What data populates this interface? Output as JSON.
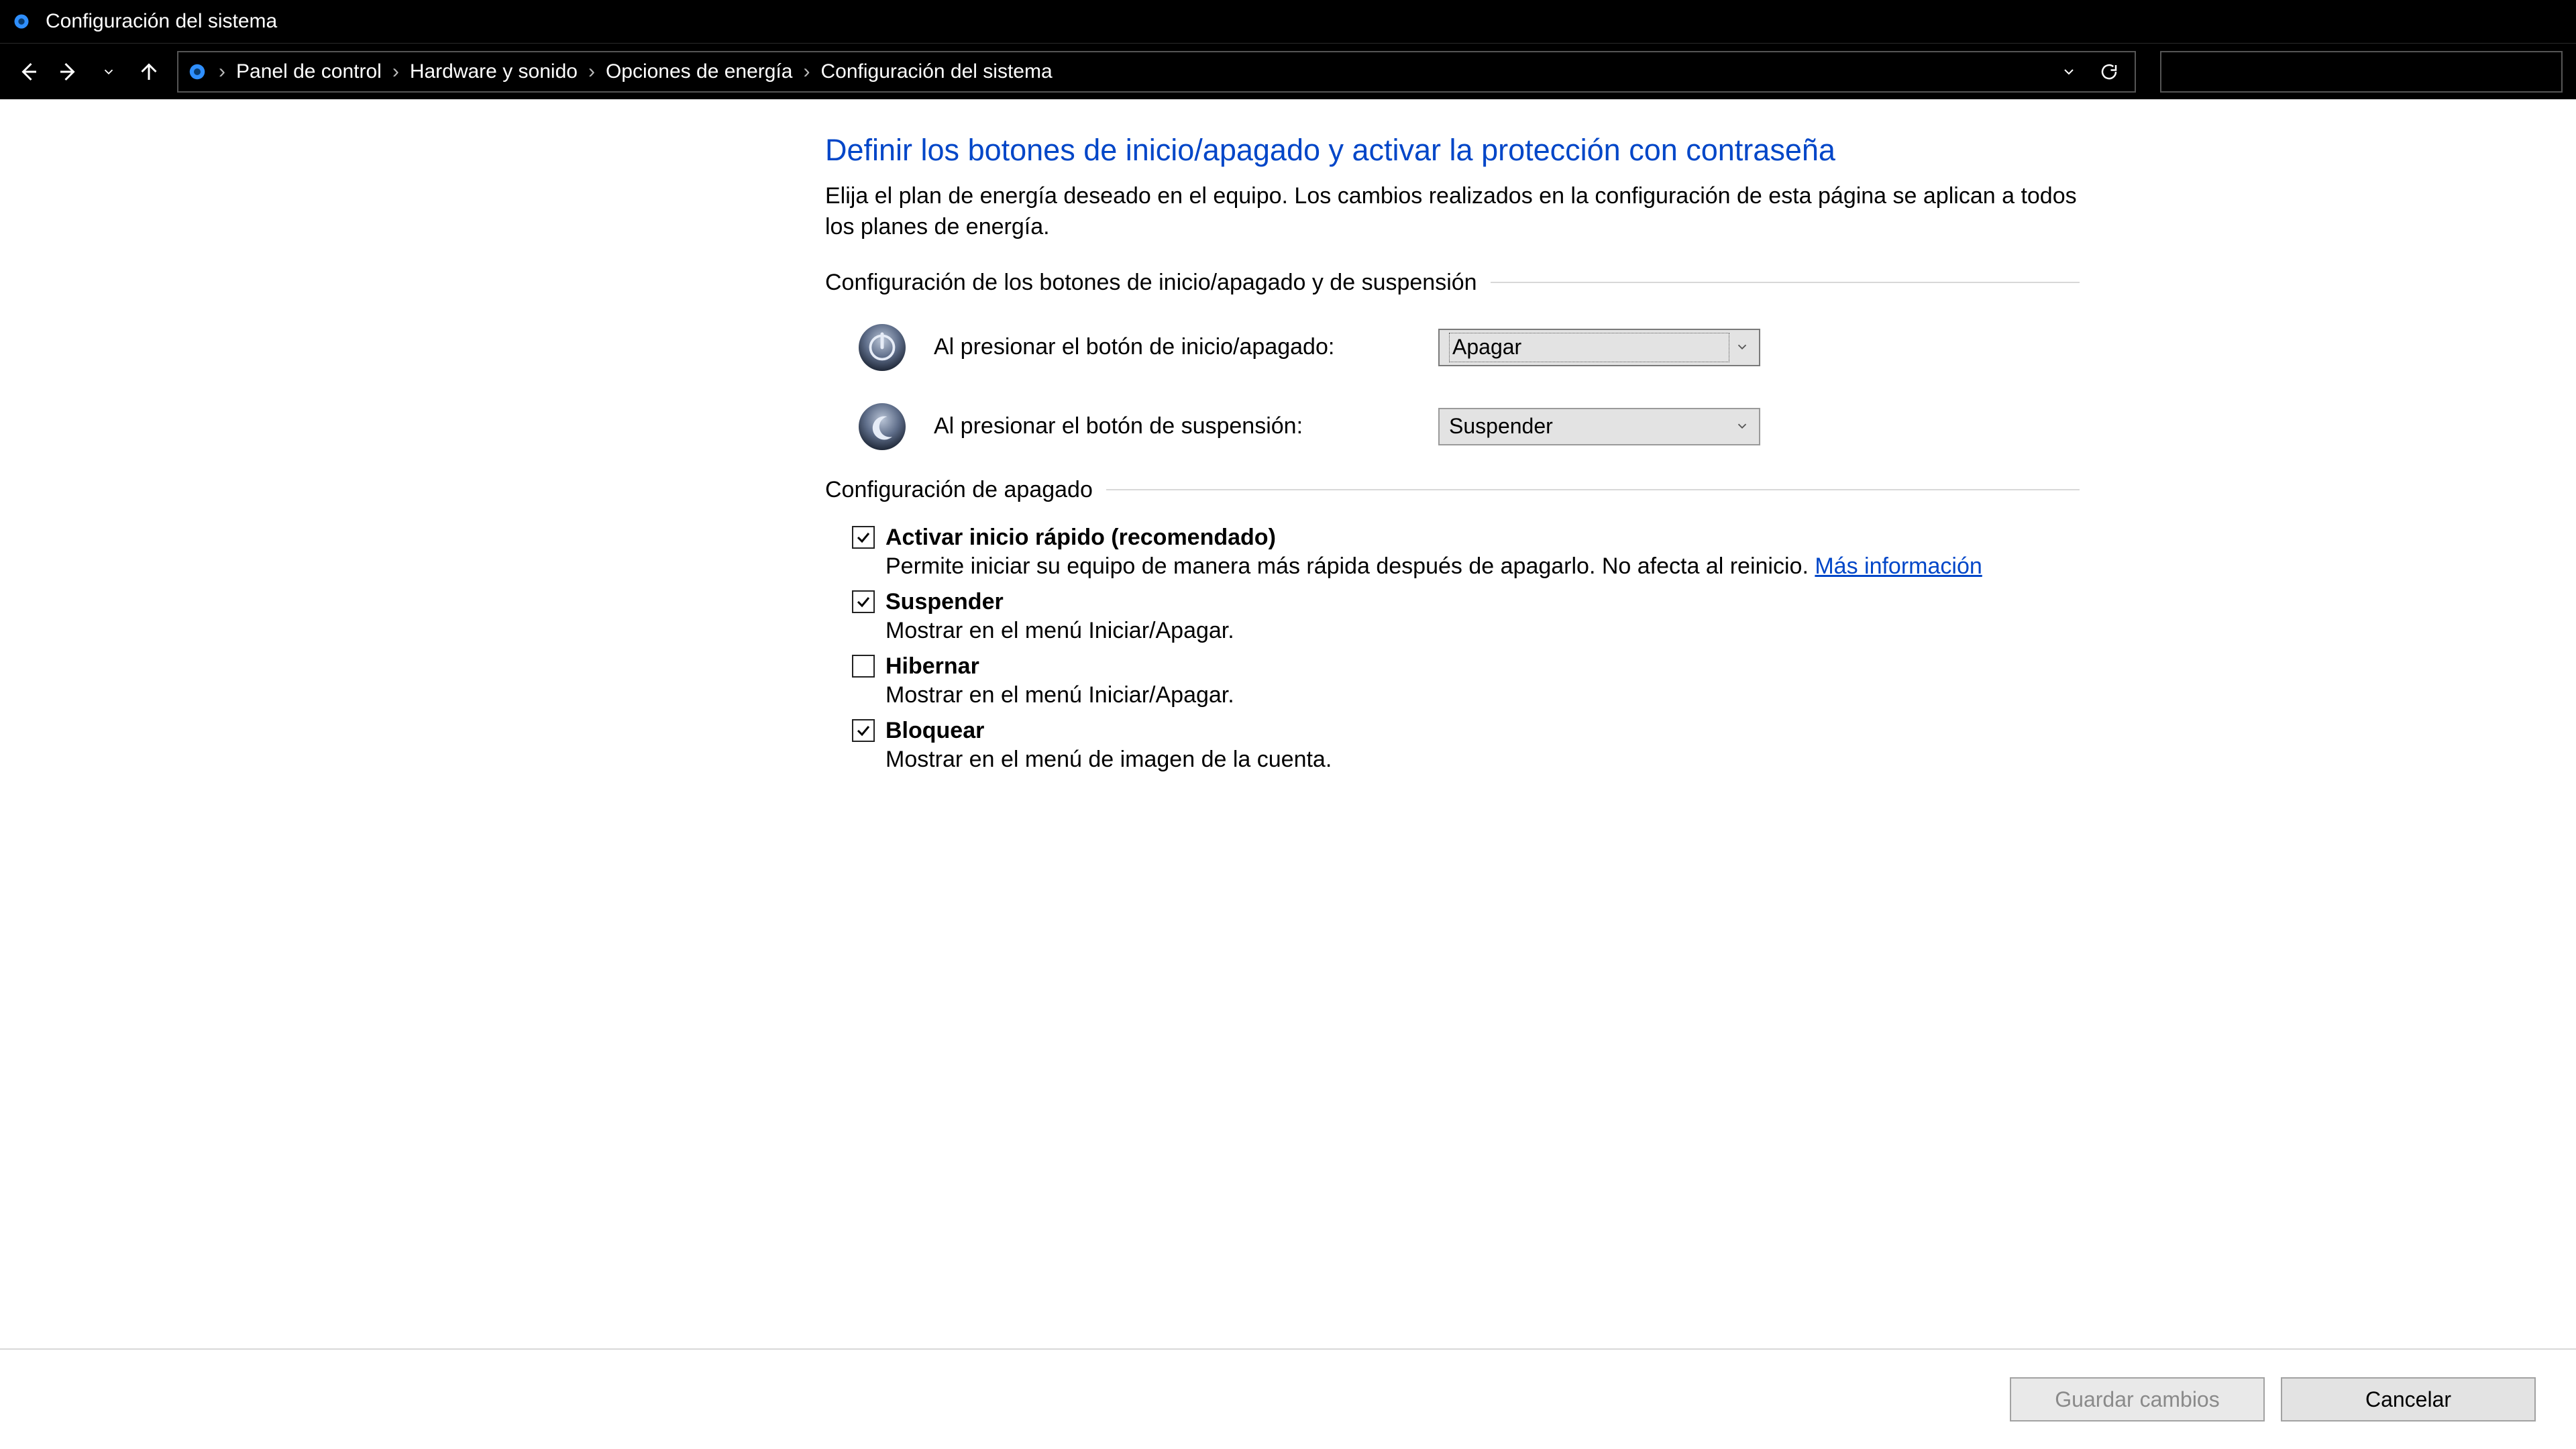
{
  "window": {
    "title": "Configuración del sistema"
  },
  "breadcrumbs": {
    "items": [
      {
        "label": "Panel de control"
      },
      {
        "label": "Hardware y sonido"
      },
      {
        "label": "Opciones de energía"
      },
      {
        "label": "Configuración del sistema"
      }
    ]
  },
  "main": {
    "heading": "Definir los botones de inicio/apagado y activar la protección con contraseña",
    "description": "Elija el plan de energía deseado en el equipo. Los cambios realizados en la configuración de esta página se aplican a todos los planes de energía.",
    "group_buttons": {
      "legend": "Configuración de los botones de inicio/apagado y de suspensión",
      "rows": [
        {
          "label": "Al presionar el botón de inicio/apagado:",
          "value": "Apagar"
        },
        {
          "label": "Al presionar el botón de suspensión:",
          "value": "Suspender"
        }
      ]
    },
    "group_shutdown": {
      "legend": "Configuración de apagado",
      "items": [
        {
          "checked": true,
          "label": "Activar inicio rápido (recomendado)",
          "desc": "Permite iniciar su equipo de manera más rápida después de apagarlo. No afecta al reinicio. ",
          "link": "Más información"
        },
        {
          "checked": true,
          "label": "Suspender",
          "desc": "Mostrar en el menú Iniciar/Apagar."
        },
        {
          "checked": false,
          "label": "Hibernar",
          "desc": "Mostrar en el menú Iniciar/Apagar."
        },
        {
          "checked": true,
          "label": "Bloquear",
          "desc": "Mostrar en el menú de imagen de la cuenta."
        }
      ]
    }
  },
  "footer": {
    "save": "Guardar cambios",
    "cancel": "Cancelar"
  }
}
